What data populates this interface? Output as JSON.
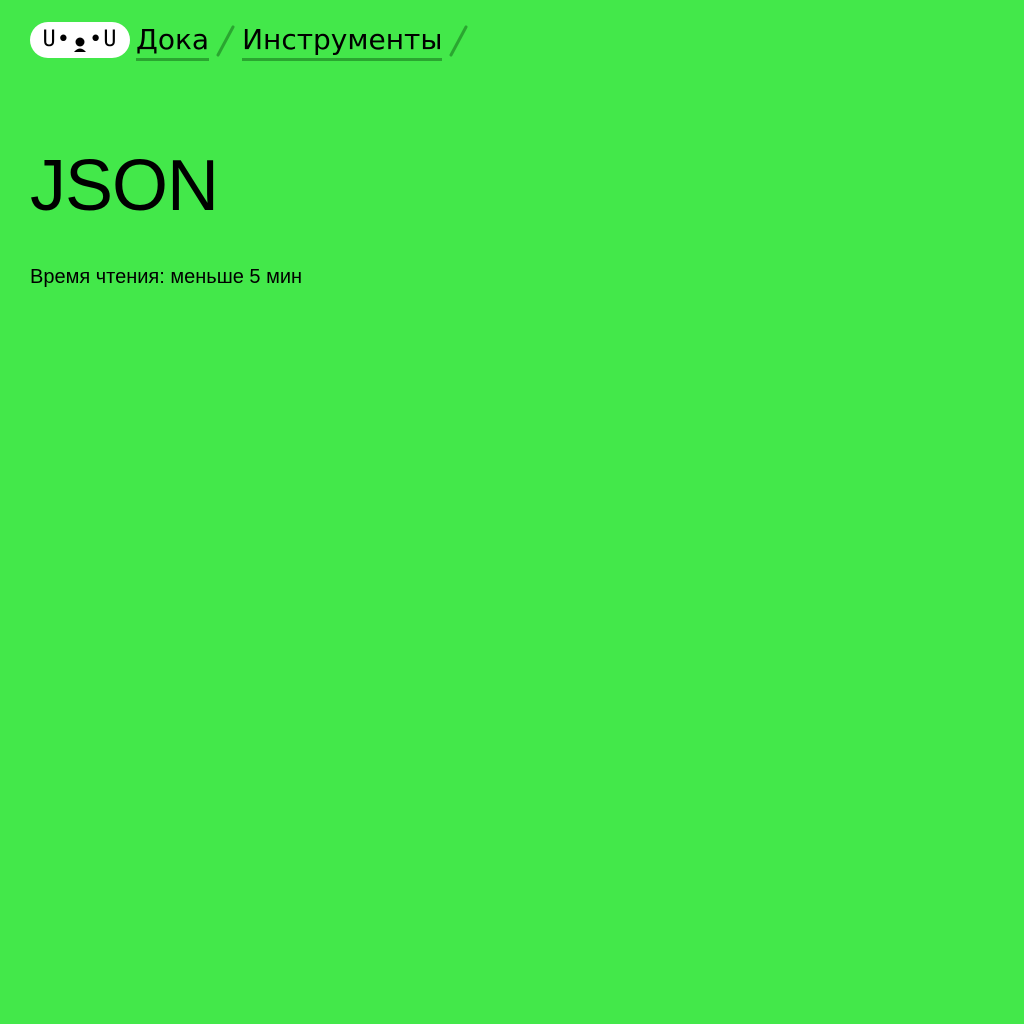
{
  "header": {
    "logo_text_left": "U•",
    "logo_text_right": "•U",
    "breadcrumb": [
      {
        "label": "Дока"
      },
      {
        "label": "Инструменты"
      }
    ]
  },
  "article": {
    "title": "JSON",
    "reading_time": "Время чтения: меньше 5 мин"
  },
  "colors": {
    "background": "#43e84a",
    "link_underline": "#2aa630",
    "logo_bg": "#ffffff"
  }
}
